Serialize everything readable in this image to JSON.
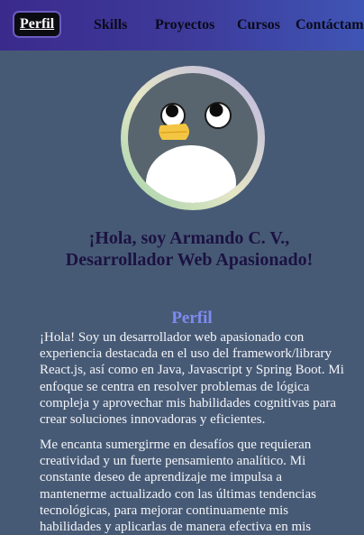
{
  "nav": {
    "items": [
      {
        "label": "Perfil",
        "active": true
      },
      {
        "label": "Skills"
      },
      {
        "label": "Proyectos"
      },
      {
        "label": "Cursos"
      },
      {
        "label": "Contáctame"
      }
    ]
  },
  "hero": {
    "avatar_icon": "penguin-avatar-icon",
    "headline": "¡Hola, soy Armando C. V., Desarrollador Web Apasionado!"
  },
  "profile": {
    "title": "Perfil",
    "paragraphs": [
      "¡Hola! Soy un desarrollador web apasionado con experiencia destacada en el uso del framework/library React.js, así como en Java, Javascript y Spring Boot. Mi enfoque se centra en resolver problemas de lógica compleja y aprovechar mis habilidades cognitivas para crear soluciones innovadoras y eficientes.",
      "Me encanta sumergirme en desafíos que requieran creatividad y un fuerte pensamiento analítico. Mi constante deseo de aprendizaje me impulsa a mantenerme actualizado con las últimas tendencias tecnológicas, para mejorar continuamente mis habilidades y aplicarlas de manera efectiva en mis"
    ]
  },
  "colors": {
    "background": "#475a75",
    "nav_gradient_start": "#3a2a8c",
    "nav_gradient_end": "#3f55b5",
    "headline": "#1b1242",
    "section_title": "#7d8cf2",
    "body_text": "#f3f4f8"
  }
}
